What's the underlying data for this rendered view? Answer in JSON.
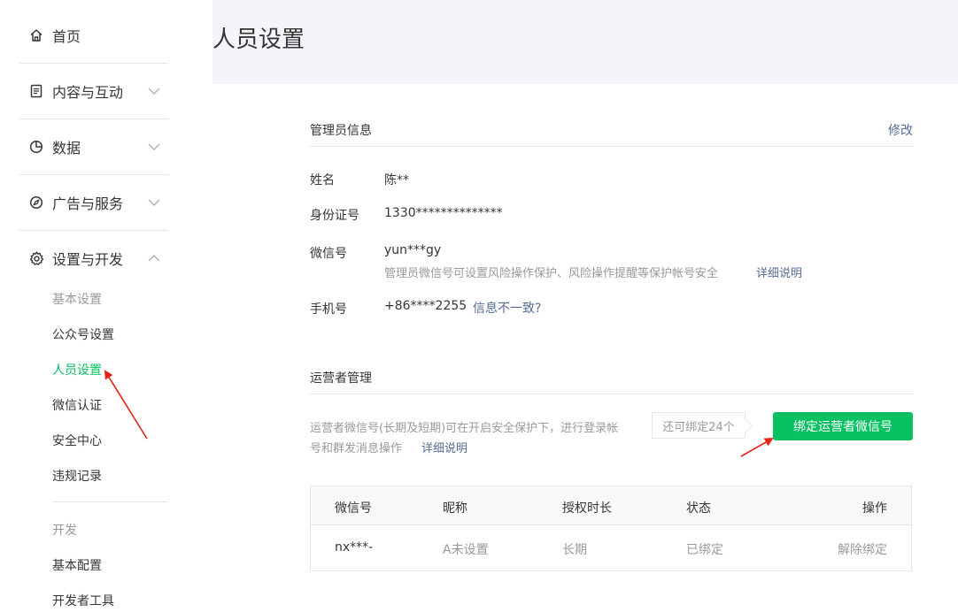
{
  "sidebar": {
    "items": [
      {
        "label": "首页",
        "icon": "home-icon"
      },
      {
        "label": "内容与互动",
        "icon": "document-icon"
      },
      {
        "label": "数据",
        "icon": "pie-chart-icon"
      },
      {
        "label": "广告与服务",
        "icon": "compass-icon"
      },
      {
        "label": "设置与开发",
        "icon": "gear-icon"
      }
    ],
    "settings_group": "基本设置",
    "settings_sub": [
      "公众号设置",
      "人员设置",
      "微信认证",
      "安全中心",
      "违规记录"
    ],
    "dev_group": "开发",
    "dev_sub": [
      "基本配置",
      "开发者工具"
    ],
    "active_color": "#07c160"
  },
  "page": {
    "title": "人员设置"
  },
  "admin": {
    "section_title": "管理员信息",
    "edit_label": "修改",
    "name_label": "姓名",
    "name_value": "陈**",
    "id_label": "身份证号",
    "id_value": "1330**************",
    "wechat_label": "微信号",
    "wechat_value": "yun***gy",
    "wechat_hint": "管理员微信号可设置风险操作保护、风险操作提醒等保护帐号安全",
    "wechat_link": "详细说明",
    "phone_label": "手机号",
    "phone_value": "+86****2255",
    "phone_link": "信息不一致?"
  },
  "operators": {
    "section_title": "运营者管理",
    "desc_line1": "运营者微信号(长期及短期)可在开启安全保护下，进行登录帐",
    "desc_line2": "号和群发消息操作",
    "desc_link": "详细说明",
    "remaining": "还可绑定24个",
    "bind_button": "绑定运营者微信号",
    "button_color": "#07c160",
    "table": {
      "headers": [
        "微信号",
        "昵称",
        "授权时长",
        "状态",
        "操作"
      ],
      "rows": [
        {
          "wechat": "nx***-",
          "nickname": "A未设置",
          "duration": "长期",
          "status": "已绑定",
          "action": "解除绑定"
        }
      ]
    }
  },
  "annotations": {
    "arrow_color": "#e8211a"
  }
}
